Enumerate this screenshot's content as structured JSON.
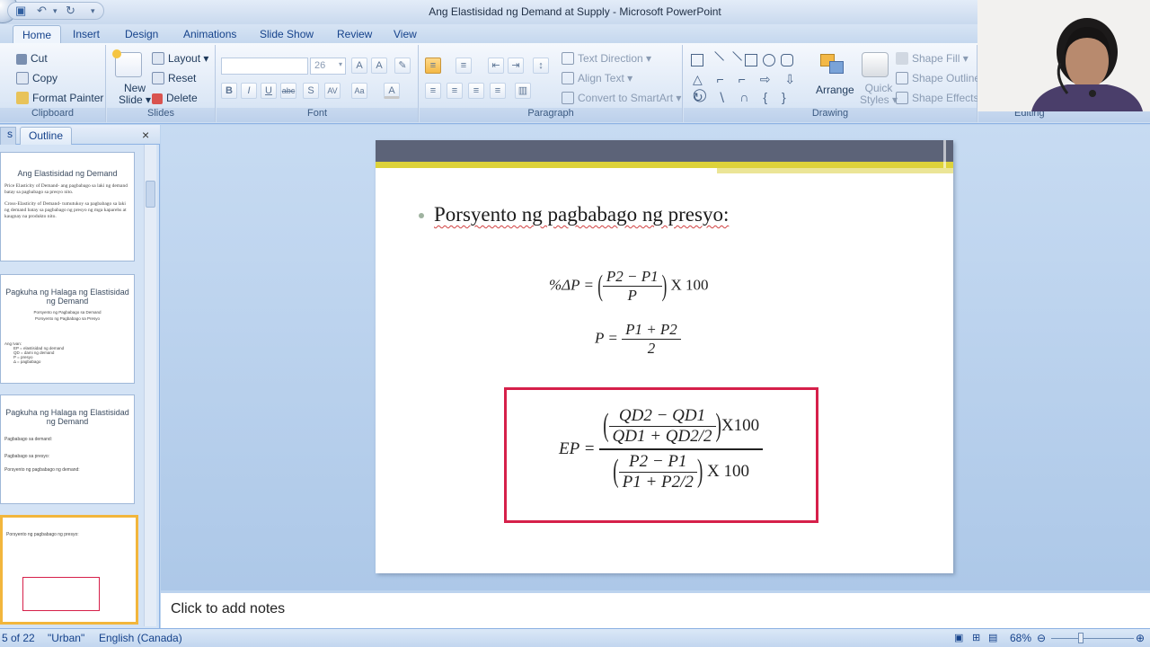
{
  "window": {
    "title": "Ang Elastisidad ng Demand at Supply - Microsoft PowerPoint"
  },
  "ribbon_tabs": [
    "Home",
    "Insert",
    "Design",
    "Animations",
    "Slide Show",
    "Review",
    "View"
  ],
  "active_tab": "Home",
  "ribbon": {
    "clipboard": {
      "label": "Clipboard",
      "cut": "Cut",
      "copy": "Copy",
      "format_painter": "Format Painter"
    },
    "slides": {
      "label": "Slides",
      "new_slide_line1": "New",
      "new_slide_line2": "Slide",
      "layout": "Layout",
      "reset": "Reset",
      "delete": "Delete"
    },
    "font": {
      "label": "Font",
      "size": "26"
    },
    "paragraph": {
      "label": "Paragraph",
      "text_direction": "Text Direction",
      "align_text": "Align Text",
      "convert_smartart": "Convert to SmartArt"
    },
    "drawing": {
      "label": "Drawing",
      "arrange": "Arrange",
      "quick_styles_line1": "Quick",
      "quick_styles_line2": "Styles",
      "shape_fill": "Shape Fill",
      "shape_outline": "Shape Outline",
      "shape_effects": "Shape Effects"
    },
    "editing": {
      "label": "Editing"
    }
  },
  "pane": {
    "tab_outline": "Outline",
    "close": "×",
    "thumbnails": [
      {
        "title": "Ang Elastisidad ng Demand",
        "lines": [
          "Price Elasticity of Demand- ang pagbabago sa laki ng demand batay sa pagbabago sa presyo nito.",
          "Cross-Elasticity of Demand- tumutukoy sa pagbabago sa laki ng demand batay sa pagbabago ng presyo ng mga kaparehs at kaugnay na produkto nito."
        ]
      },
      {
        "title": "Pagkuha ng Halaga ng Elastisidad ng Demand",
        "lines": [
          "Porsyento ng Pagbabago sa Demand",
          "Porsyento ng Pagbabago sa Presyo",
          "Ang Ivan:",
          "EP = elastisidad ng demand",
          "QD = dami ng demand",
          "P = presyo",
          "Δ = pagbabago"
        ]
      },
      {
        "title": "Pagkuha ng Halaga ng Elastisidad ng Demand",
        "lines": [
          "Pagbabago sa demand:",
          "Pagbabago sa presyo:",
          "Porsyento ng pagbabago ng demand:"
        ]
      },
      {
        "title": "",
        "lines": [
          "Porsyento ng pagbabago ng presyo:"
        ]
      }
    ]
  },
  "slide": {
    "heading": "Porsyento ng pagbabago ng presyo:",
    "eq1": {
      "lhs": "%ΔP =",
      "num": "P2 − P1",
      "den": "P",
      "tail": "X 100"
    },
    "eq2": {
      "lhs": "P =",
      "num": "P1 + P2",
      "den": "2"
    },
    "eq3": {
      "lhs": "EP =",
      "top_num": "QD2 − QD1",
      "top_den": "QD1 + QD2/2",
      "top_tail": "X100",
      "bot_num": "P2 − P1",
      "bot_den": "P1 + P2/2",
      "bot_tail": "X 100"
    },
    "box_color": "#d6204a"
  },
  "notes": {
    "placeholder": "Click to add notes"
  },
  "status": {
    "slide_counter": "5 of 22",
    "theme": "\"Urban\"",
    "language": "English (Canada)",
    "zoom": "68%"
  }
}
